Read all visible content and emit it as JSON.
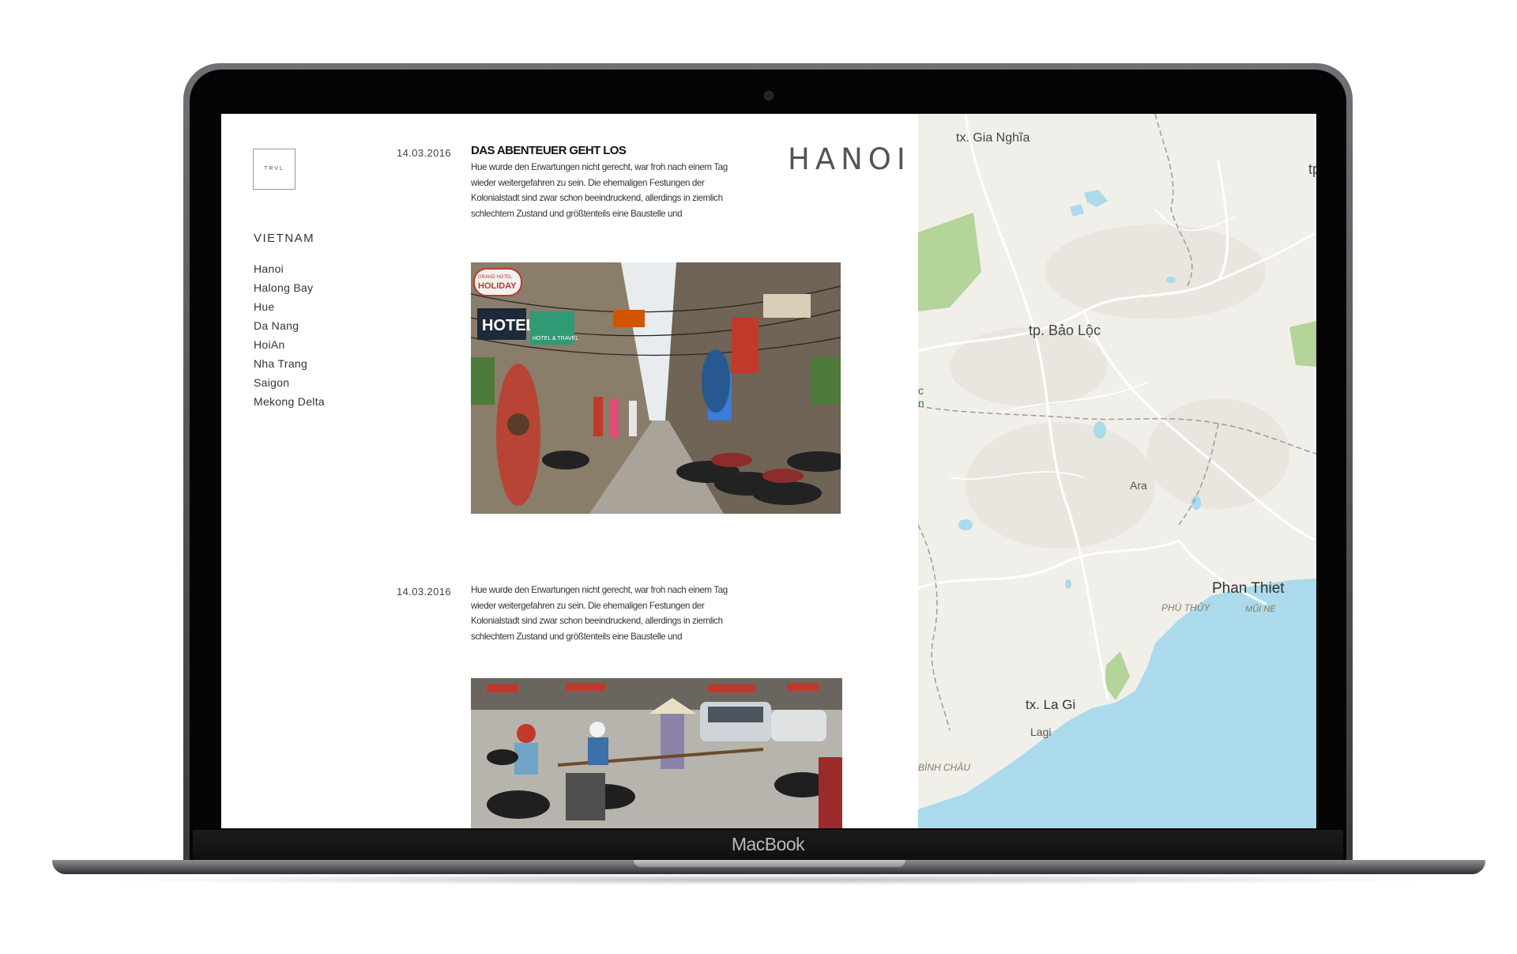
{
  "device": {
    "brand_label": "MacBook"
  },
  "site": {
    "logo_text": "TRVL",
    "country": "VIETNAM",
    "nav": [
      "Hanoi",
      "Halong Bay",
      "Hue",
      "Da Nang",
      "HoiAn",
      "Nha Trang",
      "Saigon",
      "Mekong Delta"
    ],
    "city_title": "HANOI"
  },
  "posts": [
    {
      "date": "14.03.2016",
      "title": "DAS ABENTEUER GEHT LOS",
      "body": "Hue wurde den Erwartungen nicht gerecht, war froh nach einem Tag wieder weitergefahren zu sein. Die ehemaligen Festungen der Kolonialstadt sind zwar schon beeindruckend, allerdings in ziemlich schlechtem Zustand und größtenteils eine Baustelle und"
    },
    {
      "date": "14.03.2016",
      "body": "Hue wurde den Erwartungen nicht gerecht, war froh nach einem Tag wieder weitergefahren zu sein. Die ehemaligen Festungen der Kolonialstadt sind zwar schon beeindruckend, allerdings in ziemlich schlechtem Zustand und größtenteils eine Baustelle und"
    }
  ],
  "photo1": {
    "signs": [
      "GRAND HOTEL",
      "HOLIDAY",
      "HOTEL",
      "HOTEL & TRAVEL"
    ]
  },
  "map": {
    "labels": {
      "gia_nghia": "tx. Gia Nghĩa",
      "edge_tp": "tp",
      "bao_loc": "tp. Bảo Lộc",
      "ara": "Ara",
      "phan_thiet": "Phan Thiet",
      "phu_thuy": "PHÚ THỦY",
      "mui_ne": "MŨI NÉ",
      "la_gi": "tx. La Gi",
      "lagi": "Lagi",
      "binh_chau": "BÌNH CHÂU",
      "edge_c": "c",
      "edge_n": "n"
    },
    "colors": {
      "land": "#f1efe9",
      "water": "#aadaeb",
      "park": "#b4d49a",
      "road": "#ffffff",
      "border": "#9c9c9c"
    }
  }
}
